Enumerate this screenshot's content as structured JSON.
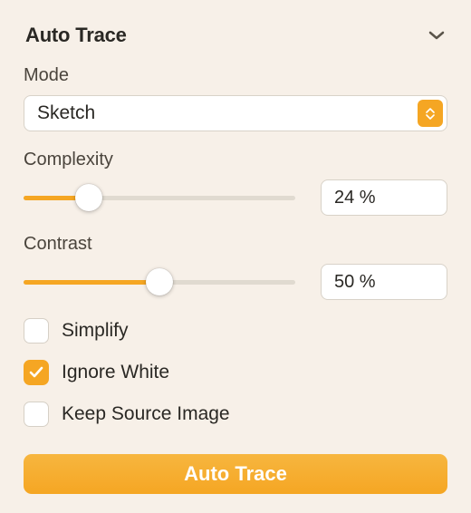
{
  "panel": {
    "title": "Auto Trace"
  },
  "mode": {
    "label": "Mode",
    "value": "Sketch"
  },
  "complexity": {
    "label": "Complexity",
    "value": "24 %",
    "percent": 24
  },
  "contrast": {
    "label": "Contrast",
    "value": "50 %",
    "percent": 50
  },
  "checks": {
    "simplify": {
      "label": "Simplify",
      "checked": false
    },
    "ignoreWhite": {
      "label": "Ignore White",
      "checked": true
    },
    "keepSource": {
      "label": "Keep Source Image",
      "checked": false
    }
  },
  "action": {
    "label": "Auto Trace"
  },
  "colors": {
    "accent": "#f5a623"
  }
}
